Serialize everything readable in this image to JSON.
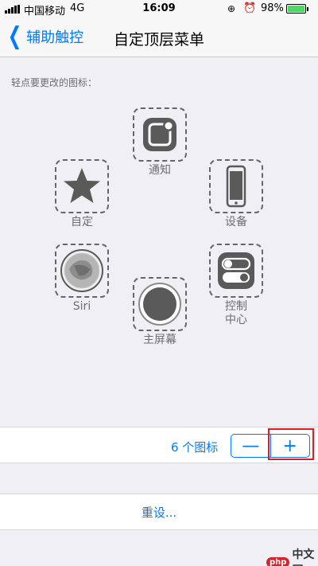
{
  "status_bar": {
    "carrier": "中国移动",
    "network": "4G",
    "time": "16:09",
    "battery_percent": "98%"
  },
  "nav": {
    "back_label": "辅助触控",
    "title": "自定顶层菜单"
  },
  "instruction": "轻点要更改的图标：",
  "menu_slots": {
    "notification": {
      "label": "通知",
      "icon": "notification-icon"
    },
    "custom": {
      "label": "自定",
      "icon": "star-icon"
    },
    "device": {
      "label": "设备",
      "icon": "iphone-icon"
    },
    "siri": {
      "label": "Siri",
      "icon": "siri-icon"
    },
    "control_center": {
      "label_line1": "控制",
      "label_line2": "中心",
      "icon": "toggle-icon"
    },
    "home": {
      "label": "主屏幕",
      "icon": "home-button-icon"
    }
  },
  "icon_count": {
    "label": "6 个图标",
    "minus": "—",
    "plus": "+"
  },
  "reset": {
    "label": "重设..."
  },
  "watermark": {
    "badge": "php",
    "text": "中文网"
  },
  "colors": {
    "accent": "#007aff",
    "background": "#efeff4",
    "icon_gray": "#5a5a5a",
    "highlight": "#e01b24"
  }
}
